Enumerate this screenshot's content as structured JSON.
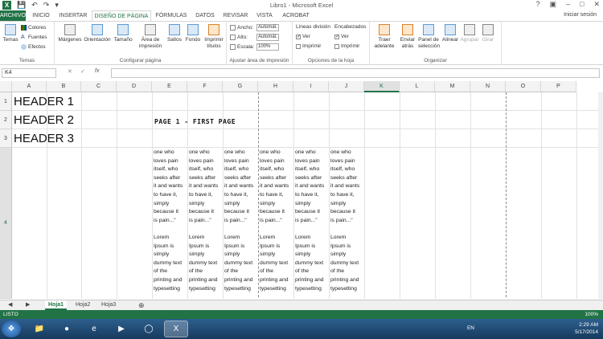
{
  "window": {
    "title": "Libro1 - Microsoft Excel",
    "signin": "Iniciar sesión"
  },
  "tabs": [
    "ARCHIVO",
    "INICIO",
    "INSERTAR",
    "DISEÑO DE PÁGINA",
    "FÓRMULAS",
    "DATOS",
    "REVISAR",
    "VISTA",
    "ACROBAT"
  ],
  "ribbon": {
    "temas": {
      "label": "Temas",
      "big": "Temas",
      "colores": "Colores",
      "fuentes": "Fuentes",
      "efectos": "Efectos"
    },
    "config": {
      "label": "Configurar página",
      "margenes": "Márgenes",
      "orientacion": "Orientación",
      "tamano": "Tamaño",
      "area": "Área de impresión",
      "saltos": "Saltos",
      "fondo": "Fondo",
      "titulos": "Imprimir títulos"
    },
    "ajustar": {
      "label": "Ajustar área de impresión",
      "ancho": "Ancho:",
      "ancho_val": "Automát.",
      "alto": "Alto:",
      "alto_val": "Automát.",
      "escala": "Escala:",
      "escala_val": "100%"
    },
    "opciones": {
      "label": "Opciones de la hoja",
      "lineas": "Líneas división",
      "encabezados": "Encabezados",
      "ver": "Ver",
      "imprimir": "Imprimir"
    },
    "organizar": {
      "label": "Organizar",
      "traer": "Traer adelante",
      "enviar": "Enviar atrás",
      "panel": "Panel de selección",
      "alinear": "Alinear",
      "agrupar": "Agrupar",
      "girar": "Girar"
    }
  },
  "formula_bar": {
    "name_box": "K4",
    "fx": "fx",
    "value": ""
  },
  "columns": [
    "A",
    "B",
    "C",
    "D",
    "E",
    "F",
    "G",
    "H",
    "I",
    "J",
    "K",
    "L",
    "M",
    "N",
    "O",
    "P"
  ],
  "rows": [
    "1",
    "2",
    "3",
    "4"
  ],
  "cells": {
    "headers": [
      "HEADER 1",
      "HEADER 2",
      "HEADER 3"
    ],
    "page_title": "PAGE 1 - FIRST PAGE",
    "col_text": "one who\nloves pain\nitself, who\nseeks after\nit and wants\nto have it,\nsimply\nbecause it\nis pain...\"\n\nLorem\nIpsum is\nsimply\ndummy text\nof the\nprinting and\ntypesetting"
  },
  "sheets": [
    "Hoja1",
    "Hoja2",
    "Hoja3"
  ],
  "status": {
    "text": "LISTO",
    "zoom": "100%"
  },
  "taskbar": {
    "lang": "EN",
    "time": "2:29 AM",
    "date": "5/17/2014"
  },
  "colors": {
    "accent": "#217346",
    "taskbar": "#1f4e79"
  }
}
